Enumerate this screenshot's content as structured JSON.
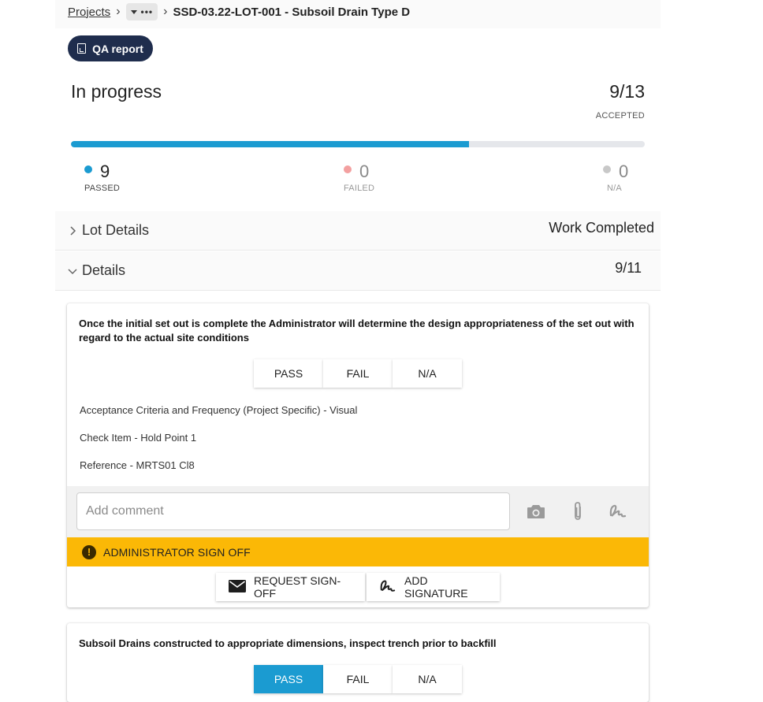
{
  "breadcrumb": {
    "projects_label": "Projects",
    "menu_dots": "•••",
    "current_label": "SSD-03.22-LOT-001 - Subsoil Drain Type D"
  },
  "qa_button": {
    "label": "QA report",
    "icon": "document-icon"
  },
  "summary": {
    "status": "In progress",
    "accepted_ratio": "9/13",
    "accepted_label": "ACCEPTED",
    "progress_fraction": 0.693
  },
  "stats": {
    "passed": {
      "value": "9",
      "label": "PASSED",
      "color": "#1b9bd1"
    },
    "failed": {
      "value": "0",
      "label": "FAILED",
      "color": "#f3a0a0"
    },
    "na": {
      "value": "0",
      "label": "N/A",
      "color": "#c8c8c8"
    }
  },
  "sections": {
    "lot_details": {
      "label": "Lot Details",
      "value": "Work Completed"
    },
    "details": {
      "label": "Details",
      "value": "9/11"
    }
  },
  "checks": [
    {
      "question": "Once the initial set out is complete the Administrator will determine the design appropriateness of the set out with regard to the actual site conditions",
      "options": [
        "PASS",
        "FAIL",
        "N/A"
      ],
      "selected": null,
      "info": [
        "Acceptance Criteria and Frequency (Project Specific) - Visual",
        "Check Item - Hold Point 1",
        "Reference - MRTS01 Cl8"
      ],
      "comment_placeholder": "Add comment",
      "signoff_label": "ADMINISTRATOR SIGN OFF",
      "signoff_color": "#fbb806",
      "request_label": "REQUEST SIGN-OFF",
      "signature_label": "ADD SIGNATURE"
    },
    {
      "question": "Subsoil Drains constructed to appropriate dimensions, inspect trench prior to backfill",
      "options": [
        "PASS",
        "FAIL",
        "N/A"
      ],
      "selected": "PASS"
    }
  ],
  "colors": {
    "accent": "#1b9bd1",
    "navy": "#1f2d4d",
    "warning": "#fbb806"
  }
}
